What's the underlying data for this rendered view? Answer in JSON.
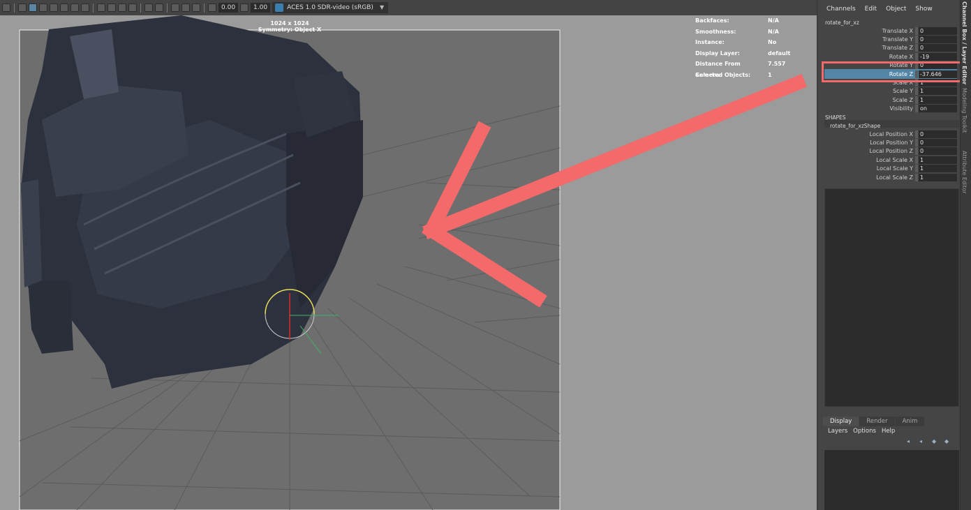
{
  "toolbar": {
    "field_a": "0.00",
    "field_b": "1.00",
    "color_space": "ACES 1.0 SDR-video (sRGB)"
  },
  "viewport": {
    "resolution": "1024 x 1024",
    "symmetry": "Symmetry: Object X",
    "hud": [
      {
        "key": "Backfaces:",
        "value": "N/A"
      },
      {
        "key": "Smoothness:",
        "value": "N/A"
      },
      {
        "key": "Instance:",
        "value": "No"
      },
      {
        "key": "Display Layer:",
        "value": "default"
      },
      {
        "key": "Distance From Camera:",
        "value": "7.557"
      },
      {
        "key": "Selected Objects:",
        "value": "1"
      }
    ]
  },
  "channel_box": {
    "menu": [
      "Channels",
      "Edit",
      "Object",
      "Show"
    ],
    "object": "rotate_for_xz",
    "attributes": [
      {
        "label": "Translate X",
        "value": "0"
      },
      {
        "label": "Translate Y",
        "value": "0"
      },
      {
        "label": "Translate Z",
        "value": "0"
      },
      {
        "label": "Rotate X",
        "value": "-19"
      },
      {
        "label": "Rotate Y",
        "value": "0"
      },
      {
        "label": "Rotate Z",
        "value": "-37.646"
      },
      {
        "label": "Scale X",
        "value": "1"
      },
      {
        "label": "Scale Y",
        "value": "1"
      },
      {
        "label": "Scale Z",
        "value": "1"
      },
      {
        "label": "Visibility",
        "value": "on"
      }
    ],
    "shapes_header": "SHAPES",
    "shape": "rotate_for_xzShape",
    "shape_attributes": [
      {
        "label": "Local Position X",
        "value": "0"
      },
      {
        "label": "Local Position Y",
        "value": "0"
      },
      {
        "label": "Local Position Z",
        "value": "0"
      },
      {
        "label": "Local Scale X",
        "value": "1"
      },
      {
        "label": "Local Scale Y",
        "value": "1"
      },
      {
        "label": "Local Scale Z",
        "value": "1"
      }
    ]
  },
  "layer_editor": {
    "tabs": [
      "Display",
      "Render",
      "Anim"
    ],
    "menu": [
      "Layers",
      "Options",
      "Help"
    ]
  },
  "side_tabs": [
    "Channel Box / Layer Editor",
    "Modeling Toolkit",
    "Attribute Editor"
  ],
  "colors": {
    "selection": "#5285a6",
    "annotation_arrow": "#f46a6a"
  }
}
